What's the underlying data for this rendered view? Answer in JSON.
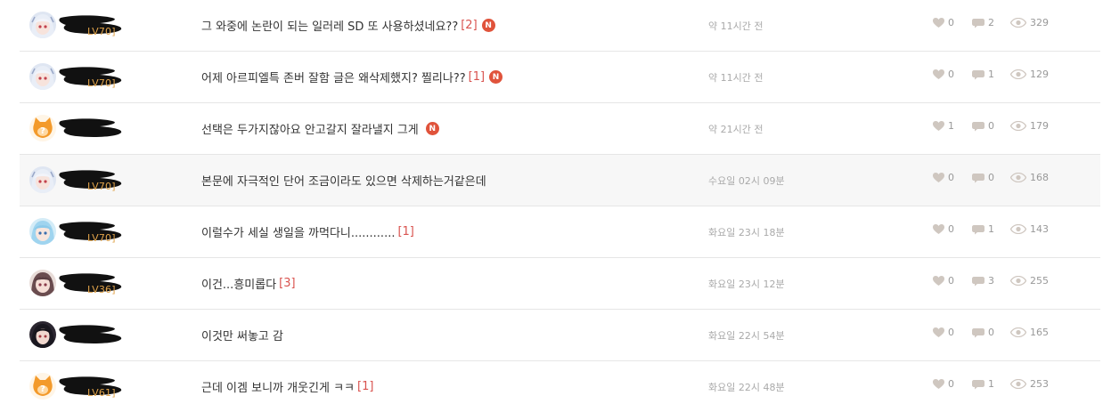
{
  "posts": [
    {
      "avatar": "anime-girl-white-hair",
      "level": "LV70",
      "title": "그 와중에 논란이 되는 일러레 SD 또 사용하셨네요??",
      "comments": "[2]",
      "is_new": true,
      "time": "약 11시간 전",
      "likes": "0",
      "comment_count": "2",
      "views": "329",
      "highlight": false
    },
    {
      "avatar": "anime-girl-white-hair",
      "level": "LV70",
      "title": "어제 아르피엘특 존버 잘함 글은 왜삭제했지? 찔리나??",
      "comments": "[1]",
      "is_new": true,
      "time": "약 11시간 전",
      "likes": "0",
      "comment_count": "1",
      "views": "129",
      "highlight": false
    },
    {
      "avatar": "orange-cat-question",
      "level": "",
      "title": "선택은 두가지잖아요 안고갈지 잘라낼지 그게",
      "comments": "",
      "is_new": true,
      "time": "약 21시간 전",
      "likes": "1",
      "comment_count": "0",
      "views": "179",
      "highlight": false
    },
    {
      "avatar": "anime-girl-white-hair",
      "level": "LV70",
      "title": "본문에 자극적인 단어 조금이라도 있으면 삭제하는거같은데",
      "comments": "",
      "is_new": false,
      "time": "수요일 02시 09분",
      "likes": "0",
      "comment_count": "0",
      "views": "168",
      "highlight": true
    },
    {
      "avatar": "anime-girl-blue-hair",
      "level": "LV70",
      "title": "이럴수가 세실 생일을 까먹다니............",
      "comments": "[1]",
      "is_new": false,
      "time": "화요일 23시 18분",
      "likes": "0",
      "comment_count": "1",
      "views": "143",
      "highlight": false
    },
    {
      "avatar": "anime-girl-dark-hair",
      "level": "LV36",
      "title": "이건...흥미롭다",
      "comments": "[3]",
      "is_new": false,
      "time": "화요일 23시 12분",
      "likes": "0",
      "comment_count": "3",
      "views": "255",
      "highlight": false
    },
    {
      "avatar": "anime-girl-black-hair",
      "level": "",
      "title": "이것만 써놓고 감",
      "comments": "",
      "is_new": false,
      "time": "화요일 22시 54분",
      "likes": "0",
      "comment_count": "0",
      "views": "165",
      "highlight": false
    },
    {
      "avatar": "orange-cat-question",
      "level": "LV61",
      "title": "근데 이겜 보니까 개웃긴게 ㅋㅋ",
      "comments": "[1]",
      "is_new": false,
      "time": "화요일 22시 48분",
      "likes": "0",
      "comment_count": "1",
      "views": "253",
      "highlight": false
    }
  ],
  "new_badge": "N",
  "colors": {
    "level": "#e1a34a",
    "comments": "#d9534f",
    "new_badge": "#e0533b",
    "muted": "#999999",
    "time": "#aaaaaa"
  },
  "icons": {
    "like": "heart-icon",
    "comment": "speech-bubble-icon",
    "view": "eye-icon"
  }
}
